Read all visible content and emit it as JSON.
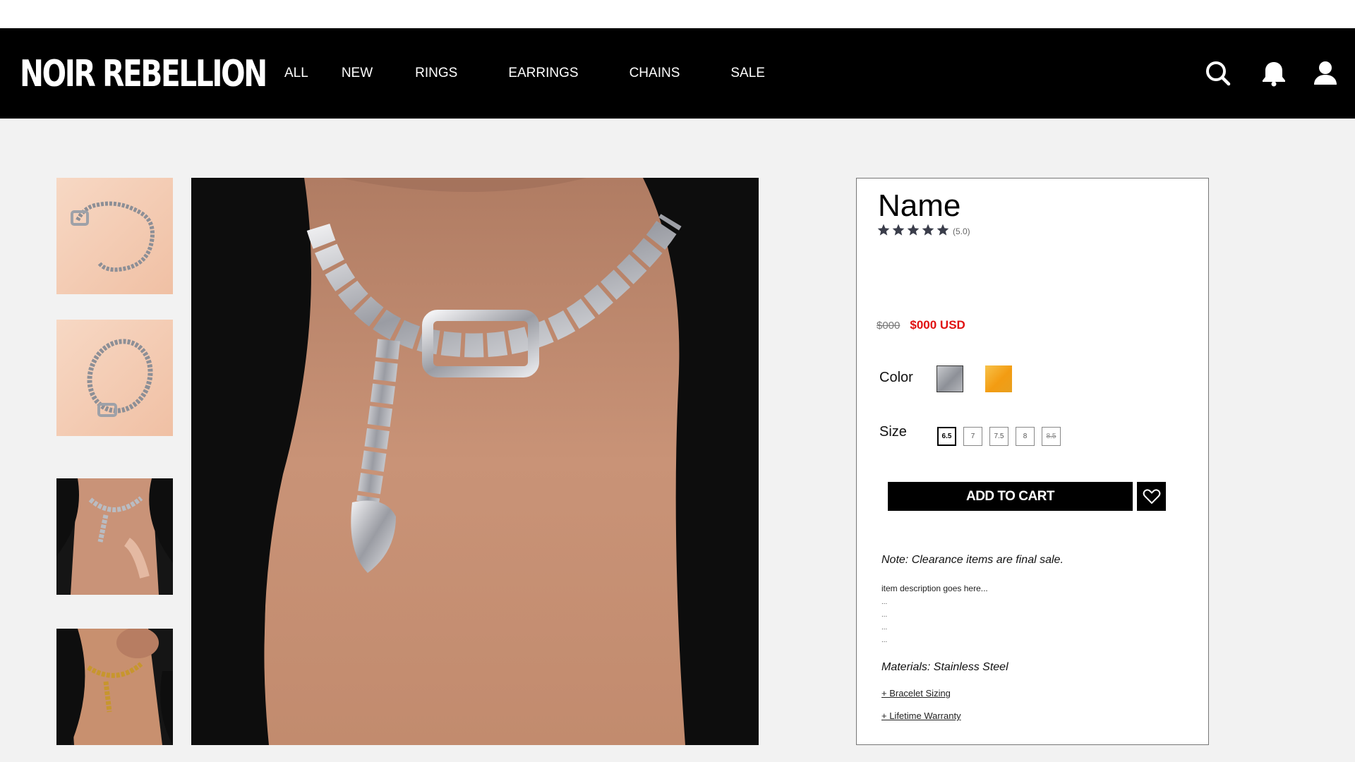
{
  "brand": {
    "logo_text": "NOIR REBELLION"
  },
  "nav": {
    "items": [
      "ALL",
      "NEW",
      "RINGS",
      "EARRINGS",
      "CHAINS",
      "SALE"
    ]
  },
  "header_icons": [
    "search-icon",
    "bell-icon",
    "user-icon"
  ],
  "gallery": {
    "thumbnails": [
      "flat-lay-silver-chain-coiled",
      "flat-lay-silver-chain-circle",
      "model-silver-chain-worn",
      "model-gold-chain-worn"
    ],
    "main_image": "model-silver-chain-closeup"
  },
  "product": {
    "name": "Name",
    "rating_text": "(5.0)",
    "rating_stars": 5,
    "old_price": "$000",
    "price": "$000 USD",
    "color_label": "Color",
    "colors": [
      "#9a9ca3",
      "#f0a820"
    ],
    "size_label": "Size",
    "sizes": [
      {
        "label": "6.5",
        "state": "selected"
      },
      {
        "label": "7",
        "state": "available"
      },
      {
        "label": "7.5",
        "state": "available"
      },
      {
        "label": "8",
        "state": "available"
      },
      {
        "label": "8.5",
        "state": "unavailable"
      }
    ],
    "add_to_cart": "ADD TO CART",
    "note": "Note: Clearance items are final sale.",
    "description": "item description goes here...",
    "description_dots": [
      "...",
      "...",
      "...",
      "..."
    ],
    "materials": "Materials: Stainless Steel",
    "links": [
      "+ Bracelet Sizing",
      "+ Lifetime Warranty"
    ]
  },
  "colors": {
    "price_red": "#e01010",
    "nav_bg": "#000000",
    "page_bg": "#f2f2f2"
  }
}
